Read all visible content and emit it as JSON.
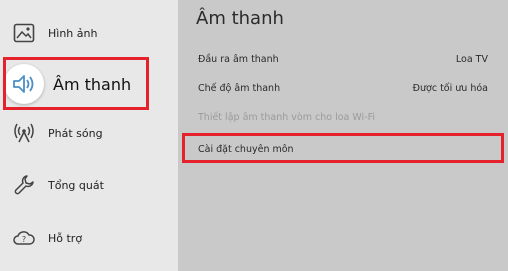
{
  "sidebar": {
    "items": [
      {
        "label": "Hình ảnh",
        "icon": "picture-icon"
      },
      {
        "label": "Âm thanh",
        "icon": "speaker-icon"
      },
      {
        "label": "Phát sóng",
        "icon": "broadcast-icon"
      },
      {
        "label": "Tổng quát",
        "icon": "wrench-icon"
      },
      {
        "label": "Hỗ trợ",
        "icon": "support-cloud-icon"
      }
    ]
  },
  "main": {
    "title": "Âm thanh",
    "rows": [
      {
        "label": "Đầu ra âm thanh",
        "value": "Loa TV"
      },
      {
        "label": "Chế độ âm thanh",
        "value": "Được tối ưu hóa"
      },
      {
        "label": "Thiết lập âm thanh vòm cho loa Wi-Fi",
        "value": ""
      },
      {
        "label": "Cài đặt chuyên môn",
        "value": ""
      }
    ]
  },
  "colors": {
    "highlight": "#e5222b"
  }
}
